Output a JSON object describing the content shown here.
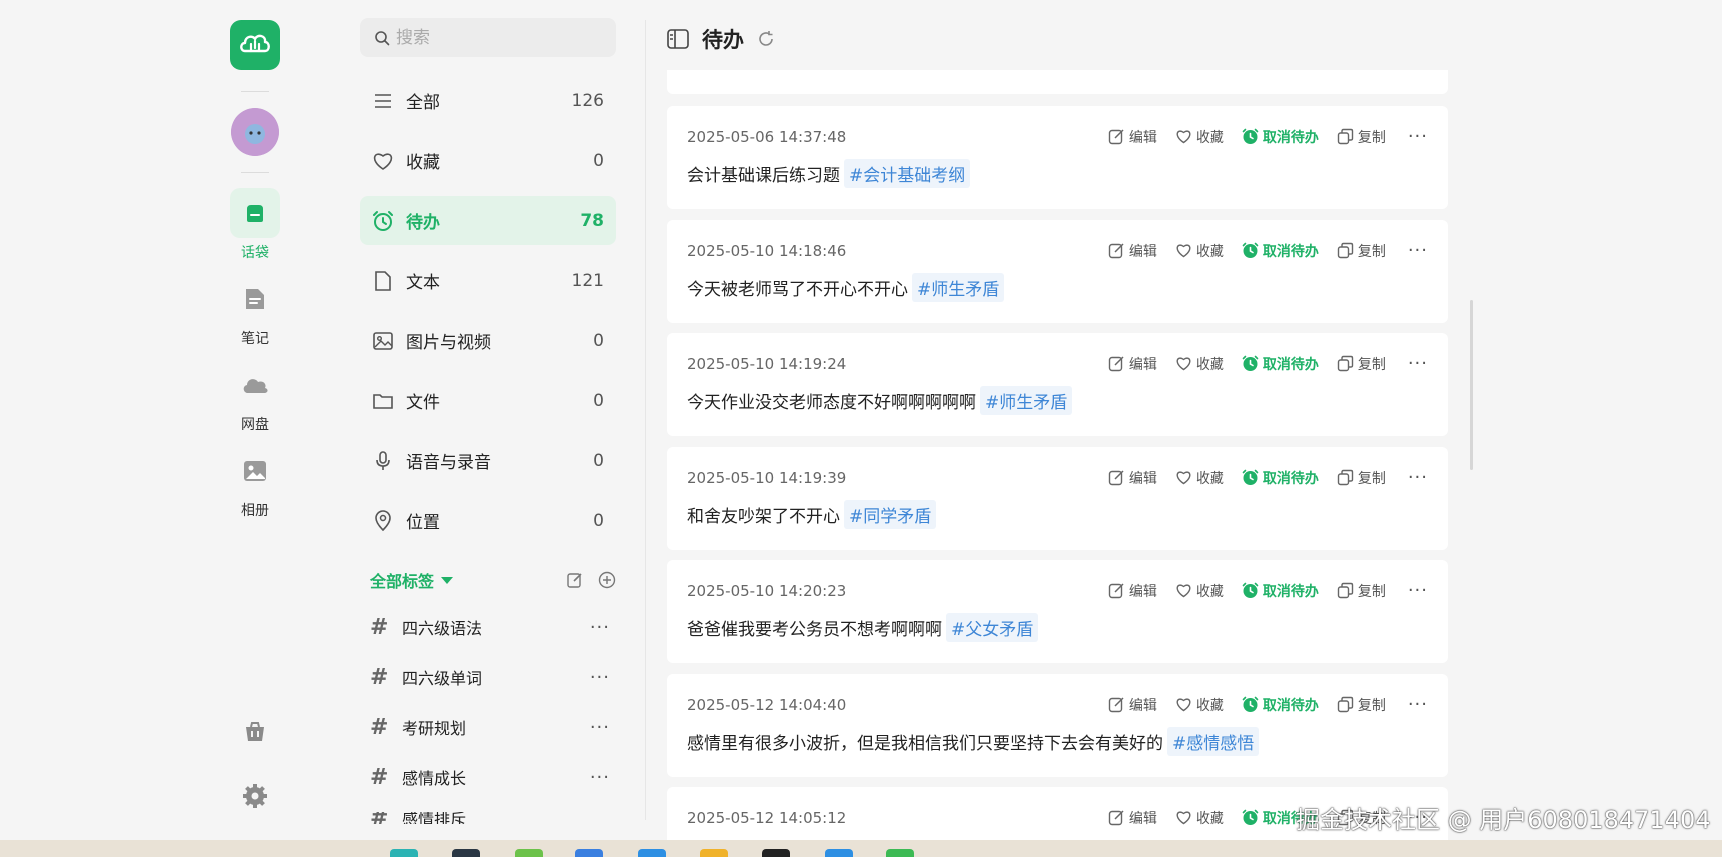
{
  "rail": {
    "items": [
      {
        "label": "话袋",
        "icon": "chat-bag-icon"
      },
      {
        "label": "笔记",
        "icon": "note-icon"
      },
      {
        "label": "网盘",
        "icon": "cloud-icon"
      },
      {
        "label": "相册",
        "icon": "album-icon"
      }
    ]
  },
  "search": {
    "placeholder": "搜索"
  },
  "categories": [
    {
      "label": "全部",
      "count": "126"
    },
    {
      "label": "收藏",
      "count": "0"
    },
    {
      "label": "待办",
      "count": "78"
    },
    {
      "label": "文本",
      "count": "121"
    },
    {
      "label": "图片与视频",
      "count": "0"
    },
    {
      "label": "文件",
      "count": "0"
    },
    {
      "label": "语音与录音",
      "count": "0"
    },
    {
      "label": "位置",
      "count": "0"
    }
  ],
  "tags": {
    "title": "全部标签",
    "items": [
      "四六级语法",
      "四六级单词",
      "考研规划",
      "感情成长",
      "感情排斥"
    ]
  },
  "main": {
    "title": "待办",
    "actions": {
      "edit": "编辑",
      "favorite": "收藏",
      "untodo": "取消待办",
      "copy": "复制"
    },
    "cards": [
      {
        "time": "2025-05-06 14:37:48",
        "text": "会计基础课后练习题",
        "tag": "#会计基础考纲"
      },
      {
        "time": "2025-05-10 14:18:46",
        "text": "今天被老师骂了不开心不开心",
        "tag": "#师生矛盾"
      },
      {
        "time": "2025-05-10 14:19:24",
        "text": "今天作业没交老师态度不好啊啊啊啊啊",
        "tag": "#师生矛盾"
      },
      {
        "time": "2025-05-10 14:19:39",
        "text": "和舍友吵架了不开心",
        "tag": "#同学矛盾"
      },
      {
        "time": "2025-05-10 14:20:23",
        "text": "爸爸催我要考公务员不想考啊啊啊",
        "tag": "#父女矛盾"
      },
      {
        "time": "2025-05-12 14:04:40",
        "text": "感情里有很多小波折，但是我相信我们只要坚持下去会有美好的",
        "tag": "#感情感悟"
      },
      {
        "time": "2025-05-12 14:05:12",
        "text": "",
        "tag": ""
      }
    ]
  },
  "watermark": "掘金技术社区 @ 用户608018471404",
  "colors": {
    "accent": "#1fb167",
    "tag": "#3e86d6",
    "activeBg": "#e3f3e9"
  }
}
